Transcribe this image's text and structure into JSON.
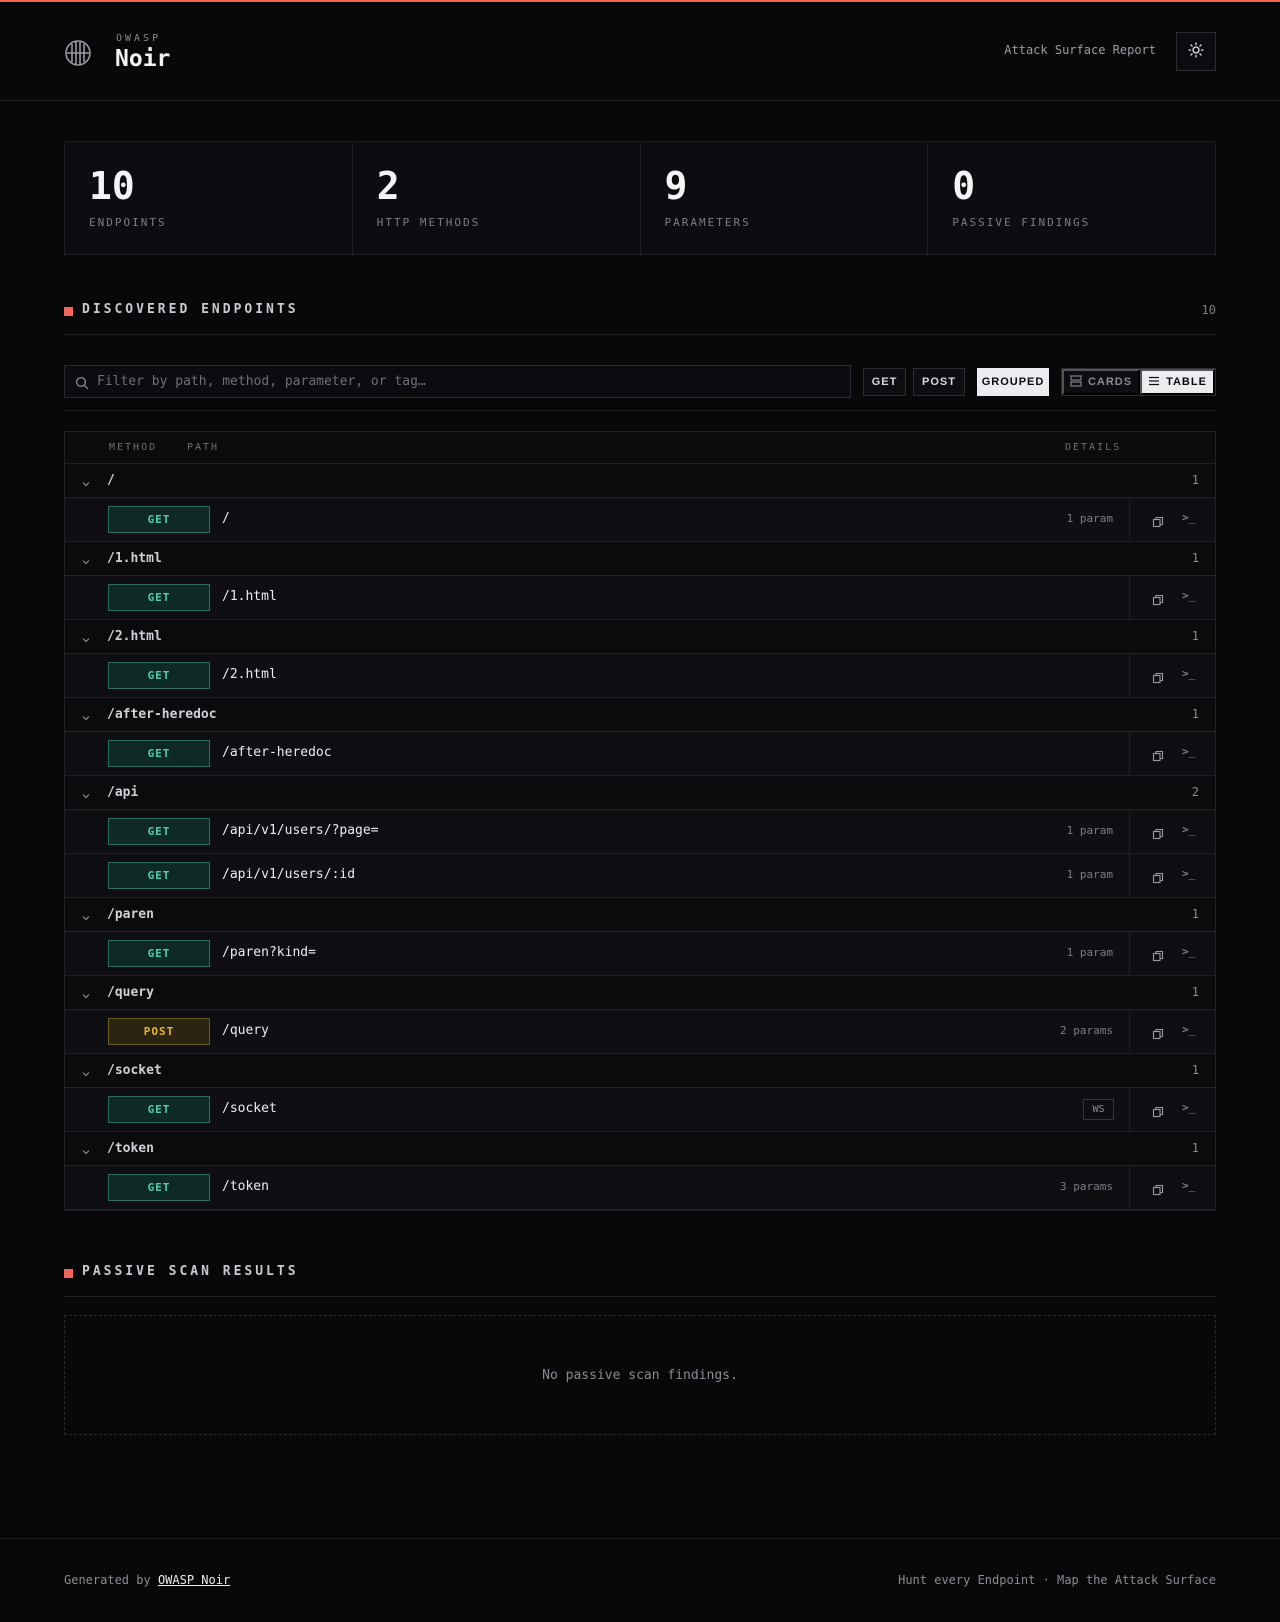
{
  "header": {
    "brand_small": "OWASP",
    "brand_name": "Noir",
    "report_label": "Attack Surface Report"
  },
  "stats": [
    {
      "value": "10",
      "label": "ENDPOINTS"
    },
    {
      "value": "2",
      "label": "HTTP METHODS"
    },
    {
      "value": "9",
      "label": "PARAMETERS"
    },
    {
      "value": "0",
      "label": "PASSIVE FINDINGS"
    }
  ],
  "endpoints_section": {
    "title": "DISCOVERED ENDPOINTS",
    "count": "10"
  },
  "toolbar": {
    "search_placeholder": "Filter by path, method, parameter, or tag…",
    "filters": [
      "GET",
      "POST"
    ],
    "grouped_label": "GROUPED",
    "cards_label": "CARDS",
    "table_label": "TABLE"
  },
  "table": {
    "headers": {
      "method": "METHOD",
      "path": "PATH",
      "details": "DETAILS"
    },
    "groups": [
      {
        "path": "/",
        "count": "1",
        "endpoints": [
          {
            "method": "GET",
            "path": "/",
            "detail": "1 param",
            "tag": ""
          }
        ]
      },
      {
        "path": "/1.html",
        "count": "1",
        "endpoints": [
          {
            "method": "GET",
            "path": "/1.html",
            "detail": "",
            "tag": ""
          }
        ]
      },
      {
        "path": "/2.html",
        "count": "1",
        "endpoints": [
          {
            "method": "GET",
            "path": "/2.html",
            "detail": "",
            "tag": ""
          }
        ]
      },
      {
        "path": "/after-heredoc",
        "count": "1",
        "endpoints": [
          {
            "method": "GET",
            "path": "/after-heredoc",
            "detail": "",
            "tag": ""
          }
        ]
      },
      {
        "path": "/api",
        "count": "2",
        "endpoints": [
          {
            "method": "GET",
            "path": "/api/v1/users/?page=",
            "detail": "1 param",
            "tag": ""
          },
          {
            "method": "GET",
            "path": "/api/v1/users/:id",
            "detail": "1 param",
            "tag": ""
          }
        ]
      },
      {
        "path": "/paren",
        "count": "1",
        "endpoints": [
          {
            "method": "GET",
            "path": "/paren?kind=",
            "detail": "1 param",
            "tag": ""
          }
        ]
      },
      {
        "path": "/query",
        "count": "1",
        "endpoints": [
          {
            "method": "POST",
            "path": "/query",
            "detail": "2 params",
            "tag": ""
          }
        ]
      },
      {
        "path": "/socket",
        "count": "1",
        "endpoints": [
          {
            "method": "GET",
            "path": "/socket",
            "detail": "",
            "tag": "WS"
          }
        ]
      },
      {
        "path": "/token",
        "count": "1",
        "endpoints": [
          {
            "method": "GET",
            "path": "/token",
            "detail": "3 params",
            "tag": ""
          }
        ]
      }
    ]
  },
  "passive_section": {
    "title": "PASSIVE SCAN RESULTS",
    "empty_text": "No passive scan findings."
  },
  "footer": {
    "generated_prefix": "Generated by",
    "generated_link": "OWASP Noir",
    "tagline": "Hunt every Endpoint · Map the Attack Surface"
  },
  "colors": {
    "accent": "#f2655a",
    "get": "#4fd1a5",
    "post": "#e8b930"
  },
  "icons": [
    "noir-logo-icon",
    "sun-icon",
    "search-icon",
    "cards-icon",
    "table-icon",
    "chevron-down-icon",
    "copy-icon",
    "terminal-icon"
  ]
}
